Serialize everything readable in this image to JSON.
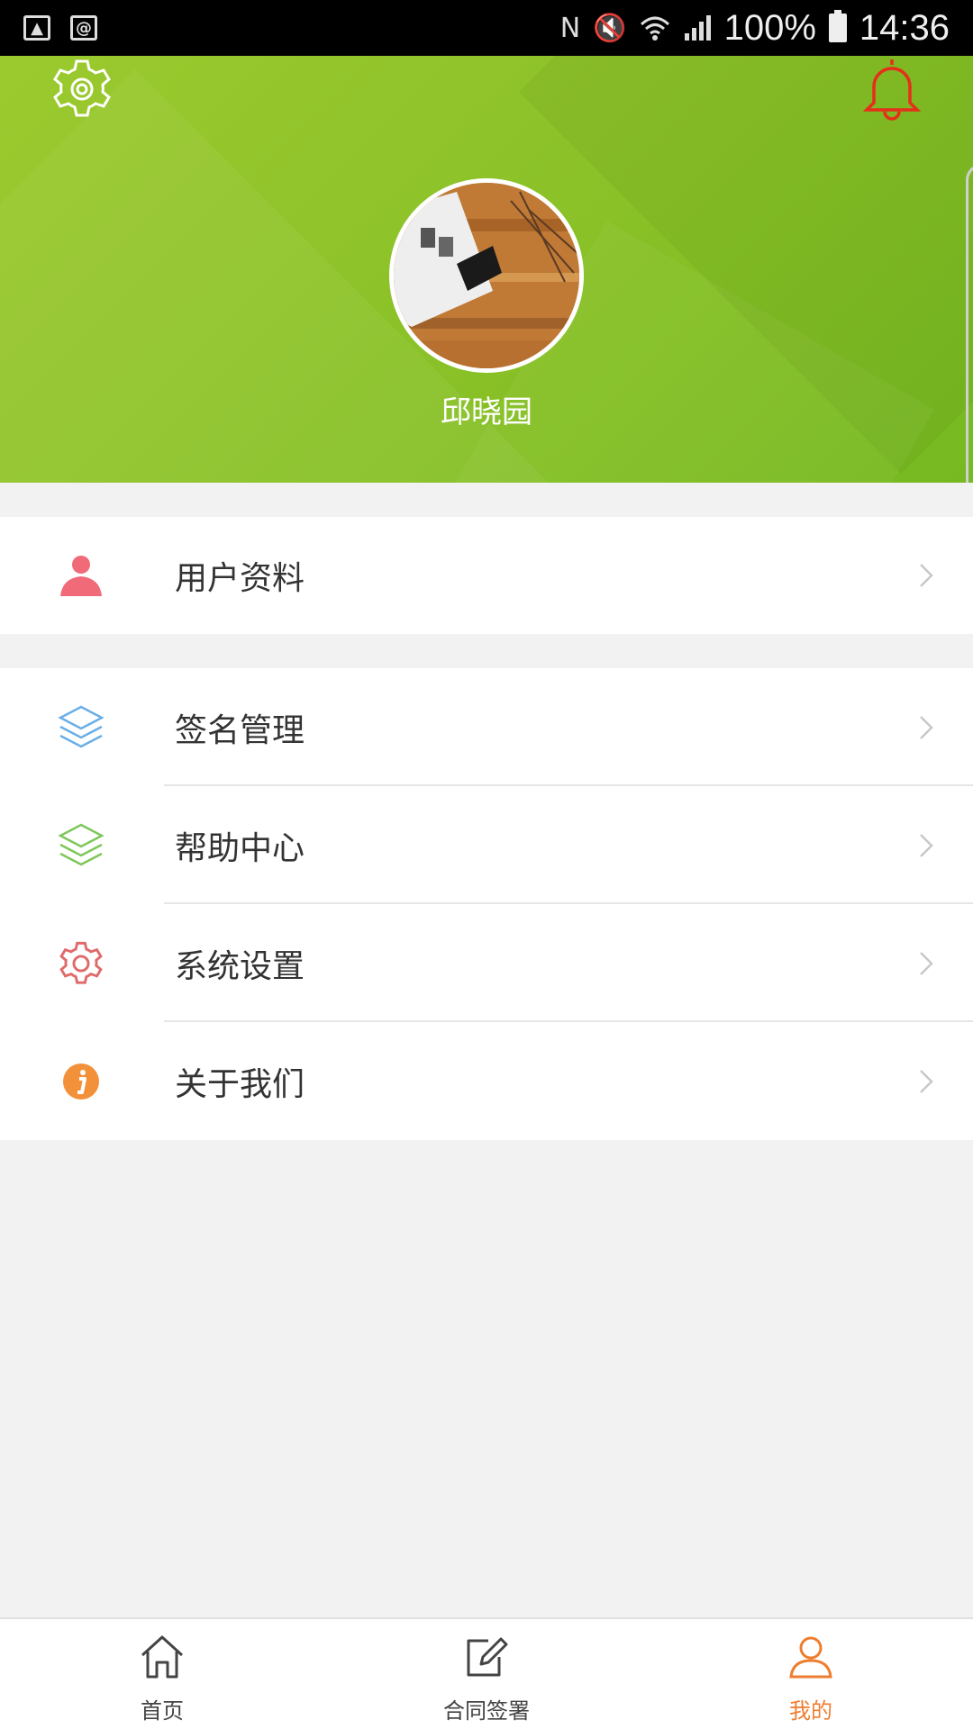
{
  "status_bar": {
    "left_icons": [
      "image-icon",
      "at-icon"
    ],
    "right_icons": [
      "nfc-icon",
      "mute-icon",
      "wifi-icon",
      "signal-icon",
      "battery-icon"
    ],
    "battery": "100%",
    "time": "14:36"
  },
  "header": {
    "settings_icon": "gear-icon",
    "bell_icon": "bell-icon",
    "username": "邱晓园",
    "accent_color": "#8fc32a"
  },
  "menu": {
    "group1": [
      {
        "label": "用户资料",
        "icon": "user-icon",
        "color": "#f06a78"
      }
    ],
    "group2": [
      {
        "label": "签名管理",
        "icon": "layers-icon",
        "color": "#6aaee6"
      },
      {
        "label": "帮助中心",
        "icon": "layers-icon",
        "color": "#7ec65a"
      },
      {
        "label": "系统设置",
        "icon": "gear-icon",
        "color": "#e06a6a"
      },
      {
        "label": "关于我们",
        "icon": "info-icon",
        "color": "#f3913a"
      }
    ]
  },
  "bottom_nav": [
    {
      "label": "首页",
      "icon": "home-icon",
      "active": false
    },
    {
      "label": "合同签署",
      "icon": "edit-icon",
      "active": false
    },
    {
      "label": "我的",
      "icon": "person-icon",
      "active": true,
      "color": "#ef7d2f"
    }
  ]
}
